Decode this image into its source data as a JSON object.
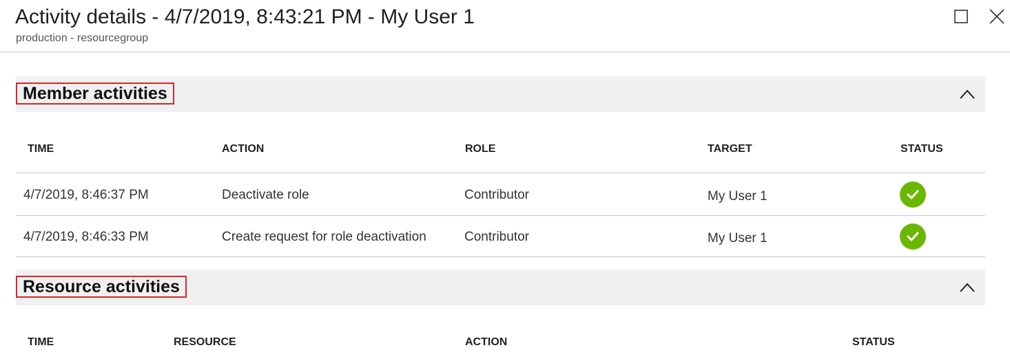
{
  "header": {
    "title": "Activity details - 4/7/2019, 8:43:21 PM - My User 1",
    "subtitle": "production - resourcegroup",
    "maximize_icon": "maximize-icon",
    "close_icon": "close-icon"
  },
  "member_activities": {
    "title": "Member activities",
    "collapse_icon": "chevron-up-icon",
    "columns": [
      "TIME",
      "ACTION",
      "ROLE",
      "TARGET",
      "STATUS"
    ],
    "rows": [
      {
        "time": "4/7/2019, 8:46:37 PM",
        "action": "Deactivate role",
        "role": "Contributor",
        "target": "My User 1",
        "status": "success"
      },
      {
        "time": "4/7/2019, 8:46:33 PM",
        "action": "Create request for role deactivation",
        "role": "Contributor",
        "target": "My User 1",
        "status": "success"
      }
    ]
  },
  "resource_activities": {
    "title": "Resource activities",
    "collapse_icon": "chevron-up-icon",
    "columns": [
      "TIME",
      "RESOURCE",
      "ACTION",
      "STATUS"
    ]
  },
  "colors": {
    "status_success": "#6bb700",
    "highlight_border": "#d8262c",
    "section_background": "#f0f0f0"
  }
}
